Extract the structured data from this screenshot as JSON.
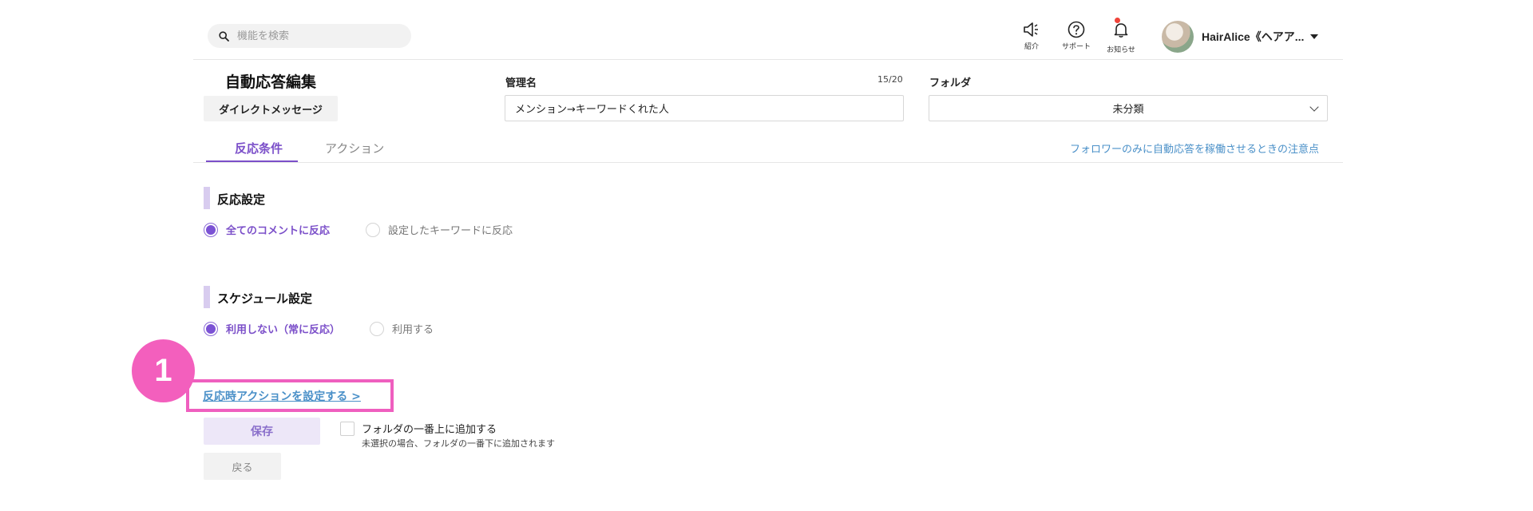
{
  "header": {
    "search_placeholder": "機能を検索",
    "icons": [
      {
        "name": "megaphone-icon",
        "label": "紹介"
      },
      {
        "name": "help-icon",
        "label": "サポート"
      },
      {
        "name": "bell-icon",
        "label": "お知らせ"
      }
    ],
    "user_name": "HairAlice《ヘアア..."
  },
  "editor": {
    "title": "自動応答編集",
    "type_badge": "ダイレクトメッセージ",
    "name_label": "管理名",
    "name_counter": "15/20",
    "name_value": "メンション→キーワードくれた人",
    "folder_label": "フォルダ",
    "folder_value": "未分類"
  },
  "tabs": {
    "active": "反応条件",
    "inactive": "アクション",
    "note_link": "フォロワーのみに自動応答を稼働させるときの注意点"
  },
  "reaction": {
    "title": "反応設定",
    "option_all": "全てのコメントに反応",
    "option_keyword": "設定したキーワードに反応"
  },
  "schedule": {
    "title": "スケジュール設定",
    "option_off": "利用しない（常に反応）",
    "option_on": "利用する"
  },
  "annotation": {
    "number": "1"
  },
  "footer": {
    "action_link": "反応時アクションを設定する >",
    "save_label": "保存",
    "back_label": "戻る",
    "top_checkbox_label": "フォルダの一番上に追加する",
    "top_checkbox_hint": "未選択の場合、フォルダの一番下に追加されます"
  },
  "colors": {
    "accent": "#7b4fc9",
    "link": "#4a90c8",
    "annotation": "#f35fbd"
  }
}
